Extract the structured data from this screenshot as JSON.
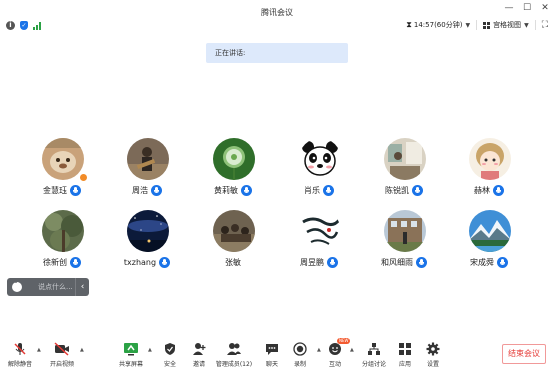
{
  "window": {
    "title": "腾讯会议"
  },
  "infobar": {
    "info_icon": "info-icon",
    "shield_icon": "shield-icon",
    "signal_icon": "signal-icon",
    "time": "14:57(60分钟)",
    "view_mode": "宫格视图"
  },
  "speaking": {
    "label": "正在讲话:"
  },
  "participants": [
    {
      "name": "金慧珏",
      "avatar": "avatar-plush-toy"
    },
    {
      "name": "周浩",
      "avatar": "avatar-guitarist"
    },
    {
      "name": "黄莉敏",
      "avatar": "avatar-dandelion"
    },
    {
      "name": "肖乐",
      "avatar": "avatar-panda"
    },
    {
      "name": "陈锐凯",
      "avatar": "avatar-room"
    },
    {
      "name": "赫林",
      "avatar": "avatar-cartoon-girl"
    },
    {
      "name": "徐新创",
      "avatar": "avatar-forest"
    },
    {
      "name": "txzhang",
      "avatar": "avatar-starry-sky"
    },
    {
      "name": "张敏",
      "avatar": "avatar-group-photo"
    },
    {
      "name": "周昱鹏",
      "avatar": "avatar-calligraphy"
    },
    {
      "name": "和风细雨",
      "avatar": "avatar-building"
    },
    {
      "name": "宋成舜",
      "avatar": "avatar-mountain"
    }
  ],
  "chat": {
    "placeholder": "说点什么..."
  },
  "toolbar": {
    "unmute": "解除静音",
    "start_video": "开启视频",
    "share_screen": "共享屏幕",
    "security": "安全",
    "invite": "邀请",
    "manage_members": "管理成员(12)",
    "chat": "聊天",
    "record": "录制",
    "reactions": "互动",
    "breakout": "分组讨论",
    "apps": "应用",
    "settings": "设置",
    "new_badge": "NEW",
    "end_meeting": "结束会议"
  },
  "colors": {
    "accent": "#1a73e8",
    "danger": "#e53935",
    "banner": "#dde9fb"
  }
}
